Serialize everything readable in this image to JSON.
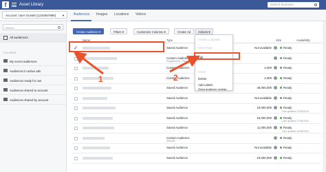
{
  "topbar": {
    "logo": "f",
    "title": "Asset Library",
    "search_placeholder": "Search Business"
  },
  "account": {
    "label": "Account: User Growth (1234567890)"
  },
  "tabs": [
    {
      "label": "Audiences"
    },
    {
      "label": "Images"
    },
    {
      "label": "Locations"
    },
    {
      "label": "Videos"
    }
  ],
  "sidebar": {
    "search_placeholder": "Search",
    "all_audiences": "All audiences",
    "folders_label": "FOLDERS",
    "folders": [
      "My recent audiences",
      "Audiences in active ads",
      "Audiences ready for use",
      "Audiences shared to account",
      "Audiences shared by account"
    ]
  },
  "toolbar": {
    "create": "Create Audience ▾",
    "filters": "Filters ▾",
    "columns": "Customize Columns ▾",
    "create_ad": "Create Ad",
    "actions": "Actions ▾"
  },
  "table": {
    "headers": {
      "name": "Name",
      "type": "Type",
      "size": "Size",
      "availability": "Availability"
    },
    "rows": [
      {
        "type": "Saved Audience",
        "sub": "",
        "size": "Not available",
        "avail": "Ready",
        "updated": ""
      },
      {
        "type": "Custom Audience",
        "sub": "Engagement - Page",
        "size": "",
        "avail": "Ready",
        "updated": ""
      },
      {
        "type": "Custom Audience",
        "sub": "",
        "size": "2,000",
        "avail": "Ready",
        "updated": ""
      },
      {
        "type": "Custom Audience",
        "sub": "",
        "size": "2,000",
        "avail": "Ready",
        "updated": ""
      },
      {
        "type": "Saved Audience",
        "sub": "",
        "size": "48,000,000",
        "avail": "Ready",
        "updated": ""
      },
      {
        "type": "Saved Audience",
        "sub": "",
        "size": "Not available",
        "avail": "Ready",
        "updated": ""
      },
      {
        "type": "Saved Audience",
        "sub": "",
        "size": "19,000,000",
        "avail": "Ready",
        "updated": "Last updated 01/28/2018"
      },
      {
        "type": "Saved Audience",
        "sub": "",
        "size": "18,000,000",
        "avail": "Ready",
        "updated": "Last updated 27/08/2016"
      },
      {
        "type": "Saved Audience",
        "sub": "",
        "size": "11,000,000",
        "avail": "Ready",
        "updated": "Last updated 26/08/2016"
      },
      {
        "type": "Custom Audience",
        "sub": "Website",
        "size": "",
        "avail": "Ready",
        "updated": ""
      },
      {
        "type": "Saved Audience",
        "sub": "",
        "size": "Not available",
        "avail": "Ready",
        "updated": ""
      },
      {
        "type": "Saved Audience",
        "sub": "",
        "size": "19,000,000",
        "avail": "Ready",
        "updated": ""
      }
    ]
  },
  "dropdown": {
    "items": [
      "Create Lookalike",
      "View Page",
      "Edit",
      "Share",
      "Delete",
      "Add Labels",
      "Show audience overlap"
    ]
  },
  "annotations": {
    "label_1": "1",
    "label_2": "2",
    "color": "#e8532d"
  }
}
